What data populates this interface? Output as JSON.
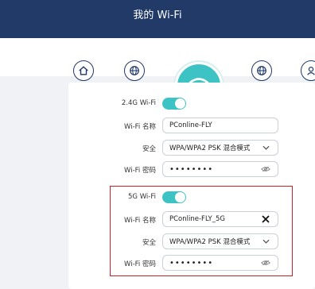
{
  "header": {
    "title": "我的 Wi-Fi"
  },
  "nav": {
    "icons": [
      "home-icon",
      "globe-icon",
      "wifi-icon",
      "globe-icon",
      "user-icon"
    ]
  },
  "wifi24": {
    "toggle_label": "2.4G Wi-Fi",
    "toggle_on": true,
    "name_label": "Wi-Fi 名称",
    "name_value": "PConline-FLY",
    "security_label": "安全",
    "security_value": "WPA/WPA2 PSK 混合模式",
    "password_label": "Wi-Fi 密码",
    "password_value": "••••••••"
  },
  "wifi5": {
    "toggle_label": "5G Wi-Fi",
    "toggle_on": true,
    "name_label": "Wi-Fi 名称",
    "name_value": "PConline-FLY_5G",
    "security_label": "安全",
    "security_value": "WPA/WPA2 PSK 混合模式",
    "password_label": "Wi-Fi 密码",
    "password_value": "••••••••"
  },
  "colors": {
    "header": "#213a67",
    "accent": "#3ec3c5",
    "highlight": "#c0232d"
  }
}
